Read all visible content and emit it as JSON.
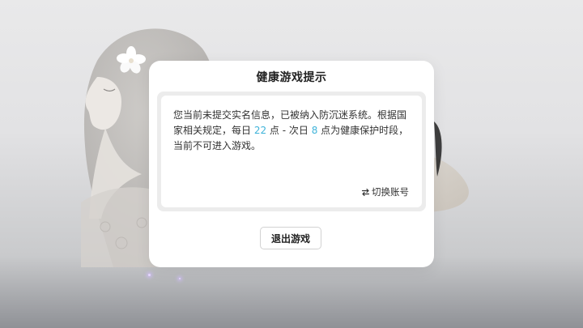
{
  "dialog": {
    "title": "健康游戏提示",
    "message": {
      "part1": "您当前未提交实名信息，已被纳入防沉迷系统。根据国家相关规定，每日 ",
      "start_hour": "22",
      "part2": " 点 - 次日 ",
      "end_hour": "8",
      "part3": " 点为健康保护时段，当前不可进入游戏。"
    },
    "switch_account_label": "切换账号",
    "exit_button_label": "退出游戏"
  },
  "colors": {
    "highlight": "#3fb3d9",
    "dialog_background": "#ffffff",
    "frame_border": "#ececec"
  },
  "icons": {
    "switch": "swap-arrows-icon"
  }
}
